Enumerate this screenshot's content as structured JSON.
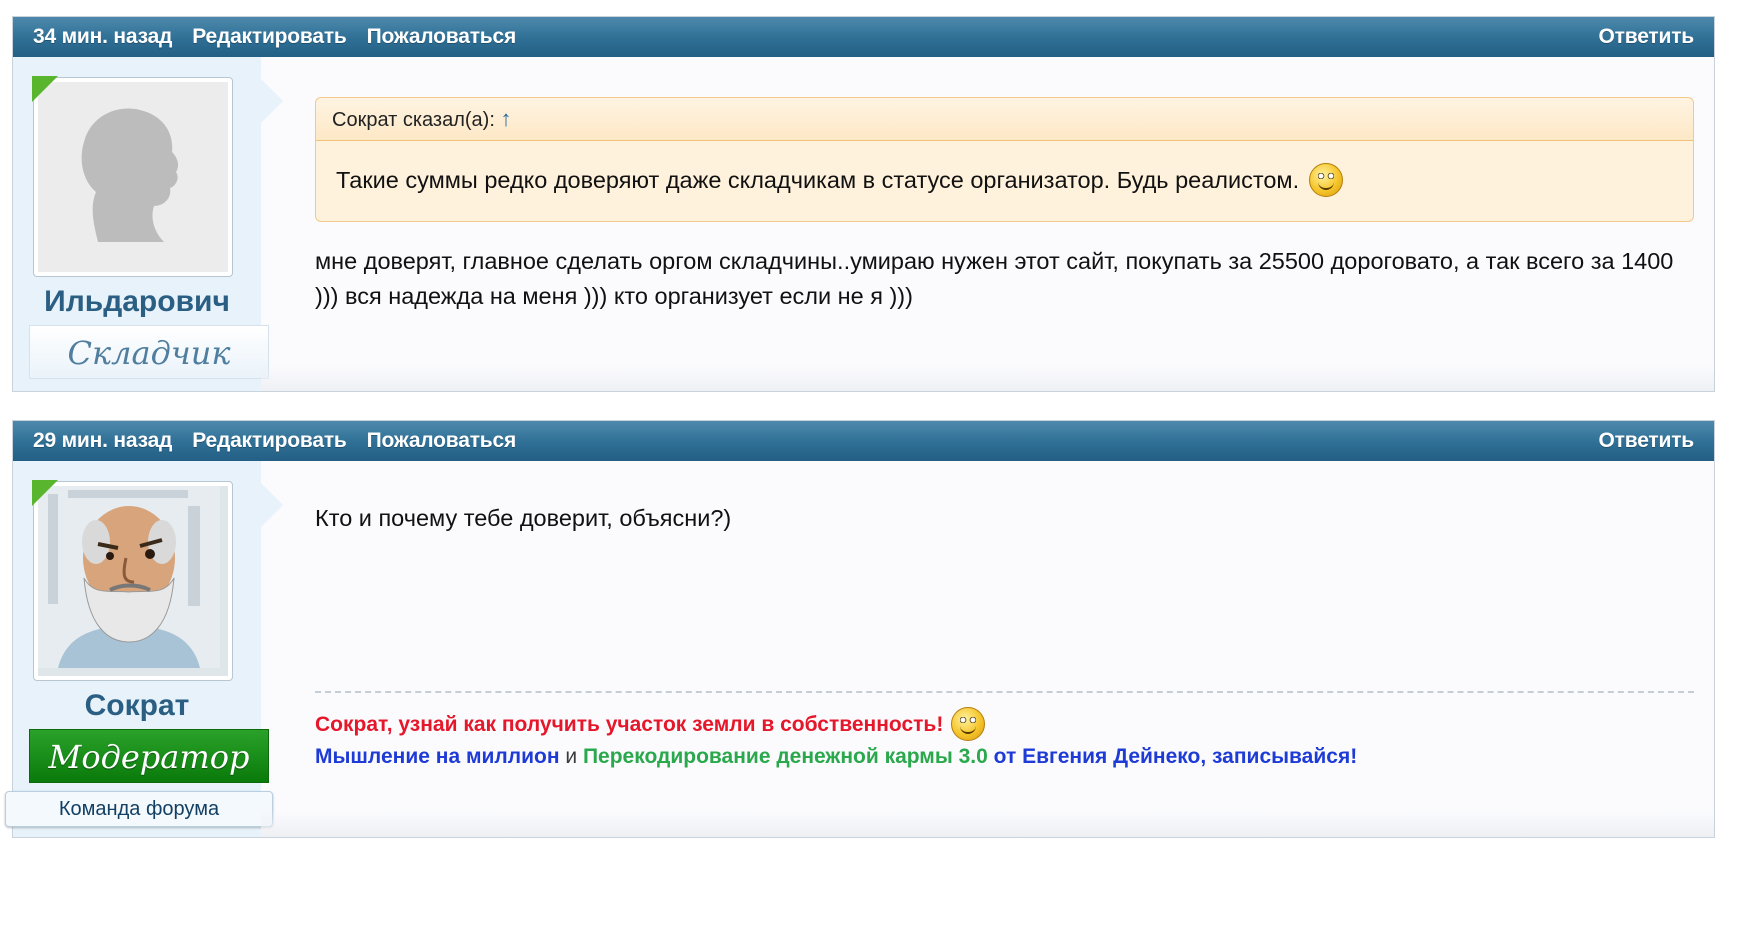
{
  "posts": [
    {
      "time": "34 мин. назад",
      "edit_label": "Редактировать",
      "report_label": "Пожаловаться",
      "reply_label": "Ответить",
      "username": "Ильдарович",
      "rank": "Складчик",
      "avatar": "default-silhouette-avatar",
      "quote": {
        "author_label": "Сократ сказал(а):",
        "arrow": "↑",
        "text": "Такие суммы редко доверяют даже складчикам в статусе организатор. Будь реалистом."
      },
      "message": "мне доверят, главное сделать оргом складчины..умираю нужен этот сайт, покупать за 25500 дороговато, а так всего за 1400 ))) вся надежда на меня ))) кто организует если не я )))"
    },
    {
      "time": "29 мин. назад",
      "edit_label": "Редактировать",
      "report_label": "Пожаловаться",
      "reply_label": "Ответить",
      "username": "Сократ",
      "rank": "Модератор",
      "team_badge": "Команда форума",
      "avatar": "socrates-avatar",
      "message": "Кто и почему тебе доверит, объясни?)",
      "signature": {
        "line1": "Сократ, узнай как получить участок земли в собственность!",
        "line2_a": "Мышление на миллион",
        "line2_and": "и",
        "line2_b": "Перекодирование денежной кармы 3.0",
        "line2_c": "от Евгения Дейнеко, записывайся!"
      }
    }
  ],
  "colors": {
    "header": "#2f6f95",
    "user_panel": "#e7f2fa",
    "quote_bg": "#fff2dd",
    "moderator": "#0a7a0a",
    "sig_red": "#e5172a",
    "sig_blue": "#1f3bd6",
    "sig_green": "#2aa84c"
  }
}
